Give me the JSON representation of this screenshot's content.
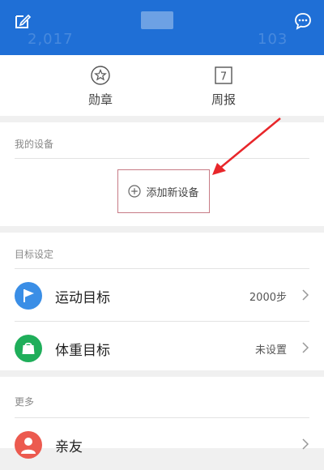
{
  "header": {
    "edit_icon": "edit-icon",
    "chat_icon": "chat-bubble-icon",
    "ghost_left": "2,017",
    "ghost_right": "103"
  },
  "shortcuts": [
    {
      "label": "勋章",
      "icon": "medal-star-icon"
    },
    {
      "label": "周报",
      "icon": "calendar-icon",
      "icon_text": "7"
    }
  ],
  "devices": {
    "title": "我的设备",
    "add_label": "添加新设备",
    "add_icon": "plus-circle-icon"
  },
  "goals": {
    "title": "目标设定",
    "items": [
      {
        "label": "运动目标",
        "value": "2000步",
        "icon": "flag-icon",
        "color": "#3a8ee6"
      },
      {
        "label": "体重目标",
        "value": "未设置",
        "icon": "scale-bag-icon",
        "color": "#1fae5a"
      }
    ]
  },
  "more": {
    "title": "更多",
    "items": [
      {
        "label": "亲友",
        "icon": "person-icon",
        "color": "#ec5a4f"
      }
    ]
  },
  "colors": {
    "header_bg": "#1f6fd6",
    "annotation_box": "#c77b86",
    "arrow": "#e8262a"
  }
}
